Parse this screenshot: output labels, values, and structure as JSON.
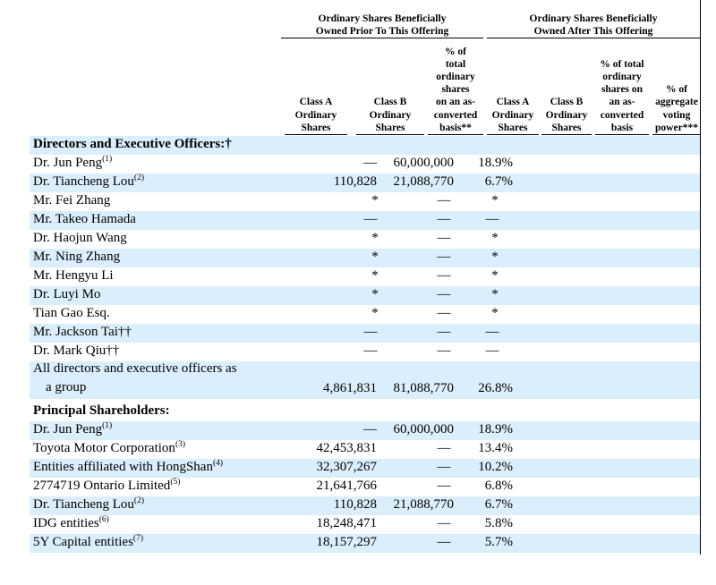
{
  "header": {
    "group_prior": "Ordinary Shares Beneficially\nOwned Prior To This Offering",
    "group_after": "Ordinary Shares Beneficially\nOwned After This Offering",
    "columns": [
      "Class A\nOrdinary\nShares",
      "Class B\nOrdinary\nShares",
      "% of\ntotal\nordinary\nshares\non an as-\nconverted\nbasis**",
      "Class A\nOrdinary\nShares",
      "Class B\nOrdinary\nShares",
      "% of total\nordinary\nshares on\nan as-\nconverted\nbasis",
      "% of\naggregate\nvoting\npower***"
    ]
  },
  "sections": {
    "directors": "Directors and Executive Officers:†",
    "principal": "Principal Shareholders:"
  },
  "rows": [
    {
      "name": "Dr. Jun Peng",
      "note": "(1)",
      "class_a": "—",
      "class_b": "60,000,000",
      "pct": "18.9%"
    },
    {
      "name": "Dr. Tiancheng Lou",
      "note": "(2)",
      "class_a": "110,828",
      "class_b": "21,088,770",
      "pct": "6.7%"
    },
    {
      "name": "Mr. Fei Zhang",
      "note": "",
      "class_a": "*",
      "class_b": "—",
      "pct": "*"
    },
    {
      "name": "Mr. Takeo Hamada",
      "note": "",
      "class_a": "—",
      "class_b": "—",
      "pct": "—"
    },
    {
      "name": "Dr. Haojun Wang",
      "note": "",
      "class_a": "*",
      "class_b": "—",
      "pct": "*"
    },
    {
      "name": "Mr. Ning Zhang",
      "note": "",
      "class_a": "*",
      "class_b": "—",
      "pct": "*"
    },
    {
      "name": "Mr. Hengyu Li",
      "note": "",
      "class_a": "*",
      "class_b": "—",
      "pct": "*"
    },
    {
      "name": "Dr. Luyi Mo",
      "note": "",
      "class_a": "*",
      "class_b": "—",
      "pct": "*"
    },
    {
      "name": "Tian Gao Esq.",
      "note": "",
      "class_a": "*",
      "class_b": "—",
      "pct": "*"
    },
    {
      "name": "Mr. Jackson Tai††",
      "note": "",
      "class_a": "—",
      "class_b": "—",
      "pct": "—"
    },
    {
      "name": "Dr. Mark Qiu††",
      "note": "",
      "class_a": "—",
      "class_b": "—",
      "pct": "—"
    },
    {
      "name_line1": "All directors and executive officers as",
      "name_line2": "a group",
      "class_a": "4,861,831",
      "class_b": "81,088,770",
      "pct": "26.8%"
    },
    {
      "name": "Dr. Jun Peng",
      "note": "(1)",
      "class_a": "—",
      "class_b": "60,000,000",
      "pct": "18.9%"
    },
    {
      "name": "Toyota Motor Corporation",
      "note": "(3)",
      "class_a": "42,453,831",
      "class_b": "—",
      "pct": "13.4%"
    },
    {
      "name": "Entities affiliated with HongShan",
      "note": "(4)",
      "class_a": "32,307,267",
      "class_b": "—",
      "pct": "10.2%"
    },
    {
      "name": "2774719 Ontario Limited",
      "note": "(5)",
      "class_a": "21,641,766",
      "class_b": "—",
      "pct": "6.8%"
    },
    {
      "name": "Dr. Tiancheng Lou",
      "note": "(2)",
      "class_a": "110,828",
      "class_b": "21,088,770",
      "pct": "6.7%"
    },
    {
      "name": "IDG entities",
      "note": "(6)",
      "class_a": "18,248,471",
      "class_b": "—",
      "pct": "5.8%"
    },
    {
      "name": "5Y Capital entities",
      "note": "(7)",
      "class_a": "18,157,297",
      "class_b": "—",
      "pct": "5.7%"
    }
  ],
  "colors": {
    "shade": "#daeefb"
  }
}
